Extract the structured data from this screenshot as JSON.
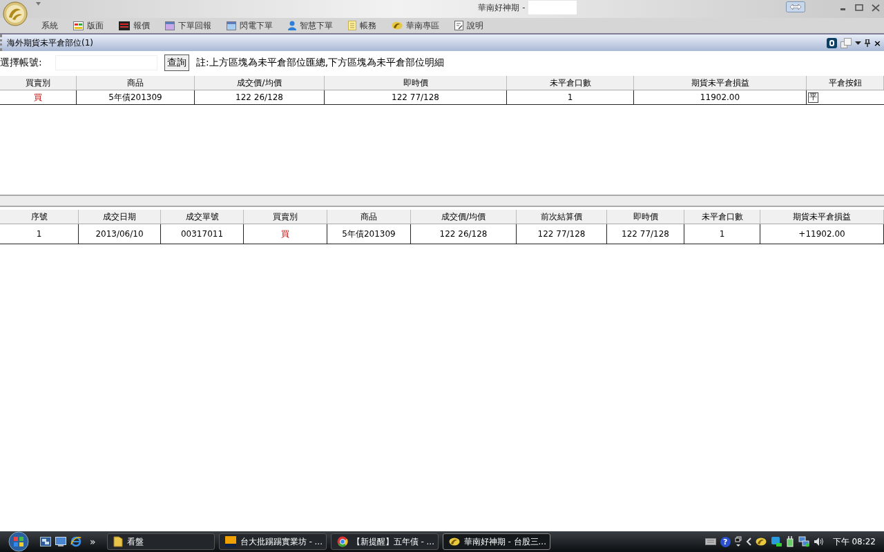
{
  "window": {
    "title": "華南好神期 -"
  },
  "menu": [
    {
      "label": "系統"
    },
    {
      "label": "版面"
    },
    {
      "label": "報價"
    },
    {
      "label": "下單回報"
    },
    {
      "label": "閃電下單"
    },
    {
      "label": "智慧下單"
    },
    {
      "label": "帳務"
    },
    {
      "label": "華南專區"
    },
    {
      "label": "說明"
    }
  ],
  "panel": {
    "title": "海外期貨未平倉部位(1)",
    "close_icon": "×"
  },
  "query": {
    "label": "選擇帳號:",
    "button": "查詢",
    "note": "註:上方區塊為未平倉部位匯總,下方區塊為未平倉部位明細"
  },
  "summary_table": {
    "columns": [
      "買賣別",
      "商品",
      "成交價/均價",
      "即時價",
      "未平倉口數",
      "期貨未平倉損益",
      "平倉按鈕"
    ],
    "rows": [
      {
        "cells": [
          {
            "text": "買",
            "kind": "buy"
          },
          {
            "text": "5年債201309",
            "kind": "plain"
          },
          {
            "text": "122 26/128",
            "kind": "plain"
          },
          {
            "text": "122 77/128",
            "kind": "plain"
          },
          {
            "text": "1",
            "kind": "plain"
          },
          {
            "text": "11902.00",
            "kind": "plain"
          }
        ],
        "close_button": "平"
      }
    ]
  },
  "detail_table": {
    "columns": [
      "序號",
      "成交日期",
      "成交單號",
      "買賣別",
      "商品",
      "成交價/均價",
      "前次結算價",
      "即時價",
      "未平倉口數",
      "期貨未平倉損益"
    ],
    "rows": [
      {
        "cells": [
          {
            "text": "1",
            "kind": "plain"
          },
          {
            "text": "2013/06/10",
            "kind": "plain"
          },
          {
            "text": "00317011",
            "kind": "plain"
          },
          {
            "text": "買",
            "kind": "buy"
          },
          {
            "text": "5年債201309",
            "kind": "plain"
          },
          {
            "text": "122 26/128",
            "kind": "plain"
          },
          {
            "text": "122 77/128",
            "kind": "plain"
          },
          {
            "text": "122 77/128",
            "kind": "plain"
          },
          {
            "text": "1",
            "kind": "plain"
          },
          {
            "text": "+11902.00",
            "kind": "plain"
          }
        ]
      }
    ]
  },
  "taskbar": {
    "chevron": "»",
    "tasks": [
      {
        "label": "看盤",
        "selected": false
      },
      {
        "label": "台大批踢踢實業坊 - ...",
        "selected": false
      },
      {
        "label": "【新提醒】五年債 - ...",
        "selected": false
      },
      {
        "label": "華南好神期 - 台股三...",
        "selected": true
      }
    ],
    "help": "?",
    "clock": "下午 08:22"
  }
}
